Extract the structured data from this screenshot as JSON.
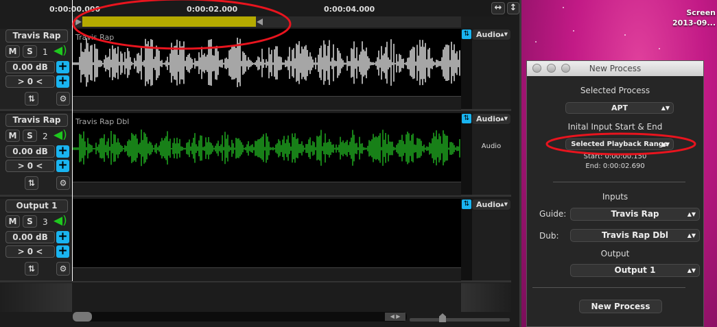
{
  "ruler": {
    "ticks": [
      "0:00:00.000",
      "0:00:02.000",
      "0:00:04.000"
    ]
  },
  "toolbar_icons": [
    "fit-horizontal-icon",
    "fit-vertical-icon"
  ],
  "selection": {
    "start": "0:00:00.150",
    "end": "0:00:02.690"
  },
  "tracks": [
    {
      "name": "Travis Rap",
      "number": "1",
      "gain": "0.00 dB",
      "offset": "> 0 <",
      "mute": "M",
      "solo": "S",
      "wave_label": "Travis Rap",
      "wave_color": "#d0d0d0",
      "output_select": "Audio",
      "output_label": ""
    },
    {
      "name": "Travis Rap",
      "number": "2",
      "gain": "0.00 dB",
      "offset": "> 0 <",
      "mute": "M",
      "solo": "S",
      "wave_label": "Travis Rap Dbl",
      "wave_color": "#1ea01e",
      "output_select": "Audio",
      "output_label": "Audio"
    },
    {
      "name": "Output 1",
      "number": "3",
      "gain": "0.00 dB",
      "offset": "> 0 <",
      "mute": "M",
      "solo": "S",
      "wave_label": "",
      "wave_color": "#1ea01e",
      "output_select": "Audio",
      "output_label": ""
    }
  ],
  "desktop": {
    "file_name": "Screen",
    "file_date": "2013-09..."
  },
  "dialog": {
    "title": "New Process",
    "selected_process_label": "Selected Process",
    "selected_process": "APT",
    "input_range_label": "Inital Input Start & End",
    "input_range": "Selected Playback Range",
    "start": "Start: 0:00:00.150",
    "end": "End: 0:00:02.690",
    "inputs_label": "Inputs",
    "guide_label": "Guide:",
    "guide": "Travis Rap",
    "dub_label": "Dub:",
    "dub": "Travis Rap Dbl",
    "output_label": "Output",
    "output": "Output 1",
    "submit": "New Process"
  },
  "colors": {
    "accent": "#19b4f0",
    "selection": "#b4aa00",
    "annotation": "#e8141e"
  }
}
